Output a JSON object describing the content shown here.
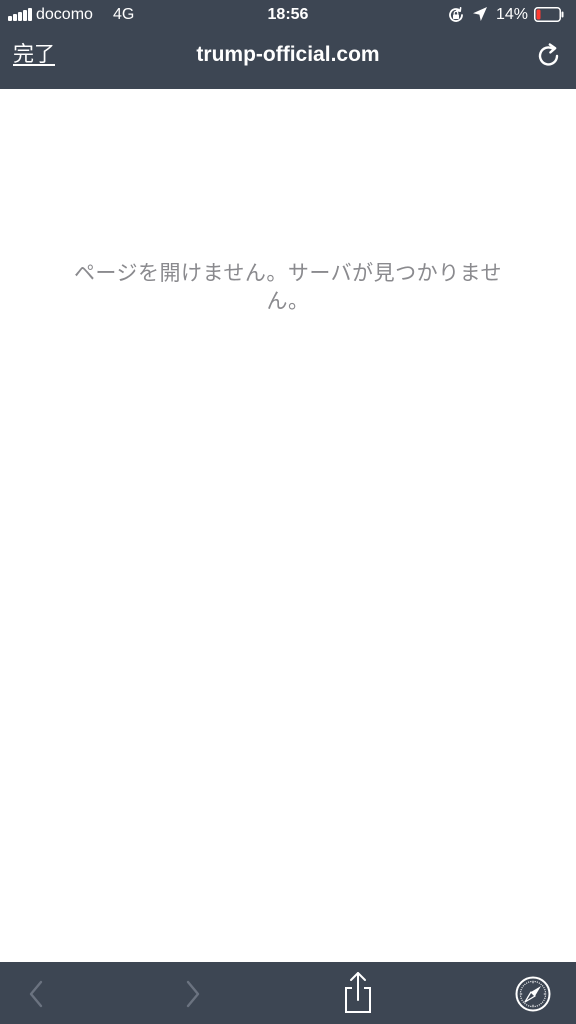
{
  "status_bar": {
    "carrier": "docomo",
    "network": "4G",
    "time": "18:56",
    "battery_percent": "14%",
    "battery_level": 0.14,
    "battery_color": "#ff3b30"
  },
  "nav": {
    "done_label": "完了",
    "title": "trump-official.com",
    "reload_icon": "reload-icon"
  },
  "content": {
    "error_message": "ページを開けません。サーバが見つかりません。"
  },
  "toolbar": {
    "back_icon": "chevron-left-icon",
    "forward_icon": "chevron-right-icon",
    "share_icon": "share-icon",
    "safari_icon": "compass-icon"
  },
  "colors": {
    "bar_background": "#3d4653",
    "bar_text": "#ffffff",
    "disabled_icon": "#6b7380",
    "error_text": "#8a8a8e"
  }
}
